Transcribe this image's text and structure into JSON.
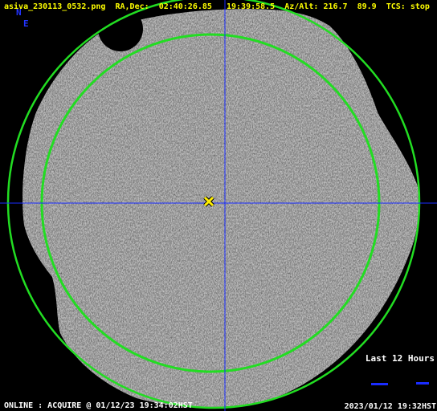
{
  "header": {
    "filename": "asiva_230113_0532.png",
    "radec_label": "RA,Dec:",
    "ra": "02:40:26.85",
    "dec": "19:39:58.5",
    "azalt_label": "Az/Alt:",
    "az": "216.7",
    "alt": "89.9",
    "tcs_label": "TCS:",
    "tcs_value": "stop"
  },
  "compass": {
    "north": "N",
    "east": "E"
  },
  "status": {
    "text": "ONLINE : ACQUIRE @ 01/12/23 19:34:02HST"
  },
  "clock": {
    "text": "2023/01/12 19:32HST"
  },
  "history": {
    "label": "Last 12 Hours"
  },
  "colors": {
    "background": "#000000",
    "header_text": "#ffff00",
    "compass": "#2233ff",
    "crosshair": "#1a2cff",
    "circle": "#22dd22",
    "target_marker": "#ffee00",
    "status_text": "#ffffff"
  },
  "icons": {
    "target": "x-marker-icon"
  }
}
